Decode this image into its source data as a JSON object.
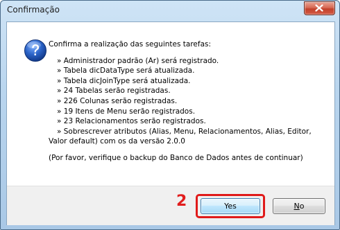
{
  "window": {
    "title": "Confirmação"
  },
  "icons": {
    "close": "close-icon",
    "question": "question-icon"
  },
  "message": {
    "intro": "Confirma a realização das seguintes tarefas:",
    "tasks": [
      "» Administrador padrão (Ar) será registrado.",
      "» Tabela dicDataType será atualizada.",
      "» Tabela dicJoinType será atualizada.",
      "» 24 Tabelas serão registradas.",
      "» 226 Colunas serão registradas.",
      "» 19 Itens de Menu serão registrados.",
      "» 23 Relacionamentos serão registrados.",
      "» Sobrescrever atributos (Alias, Menu, Relacionamentos, Alias, Editor,"
    ],
    "task_continuation": "Valor default) com os da versão 2.0.0",
    "note": "(Por favor, verifique o backup do Banco de Dados antes de continuar)"
  },
  "annotation": {
    "step_number": "2"
  },
  "buttons": {
    "yes_label": "Yes",
    "no_mnemonic": "N",
    "no_rest": "o"
  },
  "colors": {
    "annotation_red": "#e01a1a",
    "close_button": "#c2412b"
  }
}
